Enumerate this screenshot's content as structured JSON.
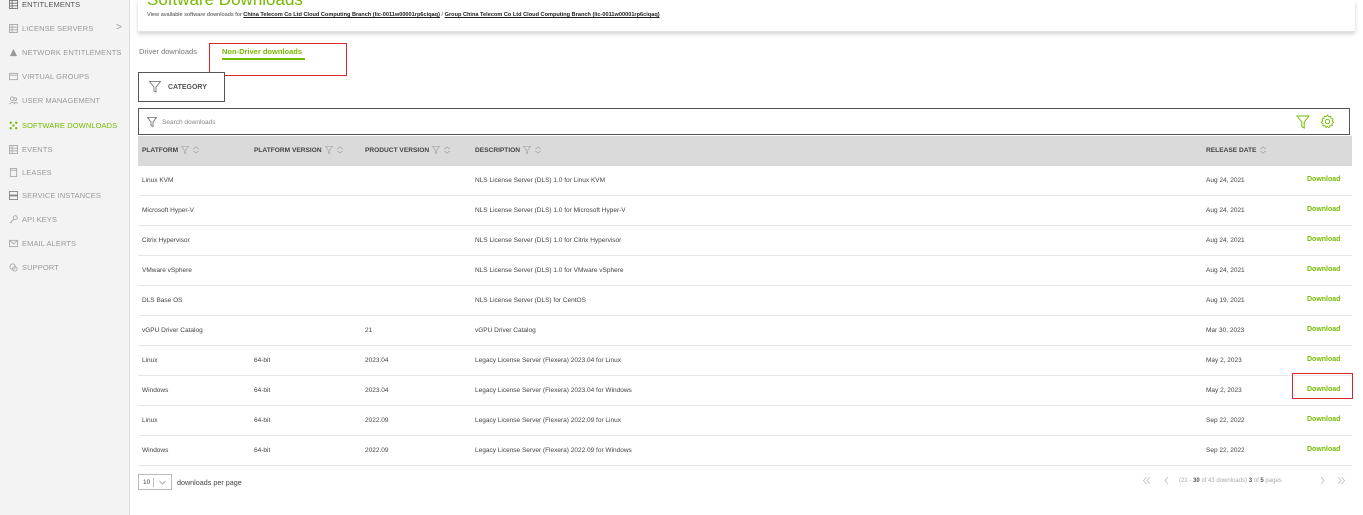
{
  "sidebar": {
    "items": [
      {
        "label": "ENTITLEMENTS",
        "icon": "grid-list-icon"
      },
      {
        "label": "LICENSE SERVERS",
        "icon": "server-list-icon"
      },
      {
        "label": "NETWORK ENTITLEMENTS",
        "icon": "network-icon"
      },
      {
        "label": "VIRTUAL GROUPS",
        "icon": "folder-icon"
      },
      {
        "label": "USER MANAGEMENT",
        "icon": "users-icon"
      },
      {
        "label": "SOFTWARE DOWNLOADS",
        "icon": "download-nodes-icon"
      },
      {
        "label": "EVENTS",
        "icon": "events-icon"
      },
      {
        "label": "LEASES",
        "icon": "document-icon"
      },
      {
        "label": "SERVICE INSTANCES",
        "icon": "instances-icon"
      },
      {
        "label": "API KEYS",
        "icon": "key-icon"
      },
      {
        "label": "EMAIL ALERTS",
        "icon": "mail-icon"
      },
      {
        "label": "SUPPORT",
        "icon": "support-icon"
      }
    ],
    "license_servers_arrow": ">"
  },
  "header": {
    "title": "Software Downloads",
    "subtitle_prefix": "View available software downloads for ",
    "org_link": "China Telecom Co Ltd Cloud Computing Branch (lic-0011w00001rp6ciqaq)",
    "separator": " / ",
    "group_link": "Group China Telecom Co Ltd Cloud Computing Branch (lic-0011w00001rp6ciqaq)"
  },
  "tabs": {
    "driver": "Driver downloads",
    "non_driver": "Non-Driver downloads"
  },
  "category": {
    "label": "CATEGORY"
  },
  "search": {
    "placeholder": "Search downloads"
  },
  "table": {
    "headers": {
      "platform": "PLATFORM",
      "platform_version": "PLATFORM VERSION",
      "product_version": "PRODUCT VERSION",
      "description": "DESCRIPTION",
      "release_date": "RELEASE DATE"
    },
    "download_label": "Download",
    "rows": [
      {
        "platform": "Linux KVM",
        "platform_version": "",
        "product_version": "",
        "description": "NLS License Server (DLS) 1.0 for Linux KVM",
        "release_date": "Aug 24, 2021"
      },
      {
        "platform": "Microsoft Hyper-V",
        "platform_version": "",
        "product_version": "",
        "description": "NLS License Server (DLS) 1.0 for Microsoft Hyper-V",
        "release_date": "Aug 24, 2021"
      },
      {
        "platform": "Citrix Hypervisor",
        "platform_version": "",
        "product_version": "",
        "description": "NLS License Server (DLS) 1.0 for Citrix Hypervisor",
        "release_date": "Aug 24, 2021"
      },
      {
        "platform": "VMware vSphere",
        "platform_version": "",
        "product_version": "",
        "description": "NLS License Server (DLS) 1.0 for VMware vSphere",
        "release_date": "Aug 24, 2021"
      },
      {
        "platform": "DLS Base OS",
        "platform_version": "",
        "product_version": "",
        "description": "NLS License Server (DLS) for CentOS",
        "release_date": "Aug 19, 2021"
      },
      {
        "platform": "vGPU Driver Catalog",
        "platform_version": "",
        "product_version": "21",
        "description": "vGPU Driver Catalog",
        "release_date": "Mar 30, 2023"
      },
      {
        "platform": "Linux",
        "platform_version": "64-bit",
        "product_version": "2023.04",
        "description": "Legacy License Server (Flexera) 2023.04 for Linux",
        "release_date": "May 2, 2023"
      },
      {
        "platform": "Windows",
        "platform_version": "64-bit",
        "product_version": "2023.04",
        "description": "Legacy License Server (Flexera) 2023.04 for Windows",
        "release_date": "May 2, 2023"
      },
      {
        "platform": "Linux",
        "platform_version": "64-bit",
        "product_version": "2022.09",
        "description": "Legacy License Server (Flexera) 2022.09 for Linux",
        "release_date": "Sep 22, 2022"
      },
      {
        "platform": "Windows",
        "platform_version": "64-bit",
        "product_version": "2022.09",
        "description": "Legacy License Server (Flexera) 2022.09 for Windows",
        "release_date": "Sep 22, 2022"
      }
    ]
  },
  "footer": {
    "per_page_value": "10",
    "per_page_label": "downloads per page",
    "range_prefix": "(21 - ",
    "range_end": "30",
    "range_mid": " of 43 downloads) ",
    "current_page": "3",
    "of_label": " of ",
    "total_pages": "5",
    "pages_label": " pages"
  },
  "colors": {
    "accent_green": "#76b900",
    "highlight_red": "#d7262c",
    "header_gray": "#dadada"
  }
}
